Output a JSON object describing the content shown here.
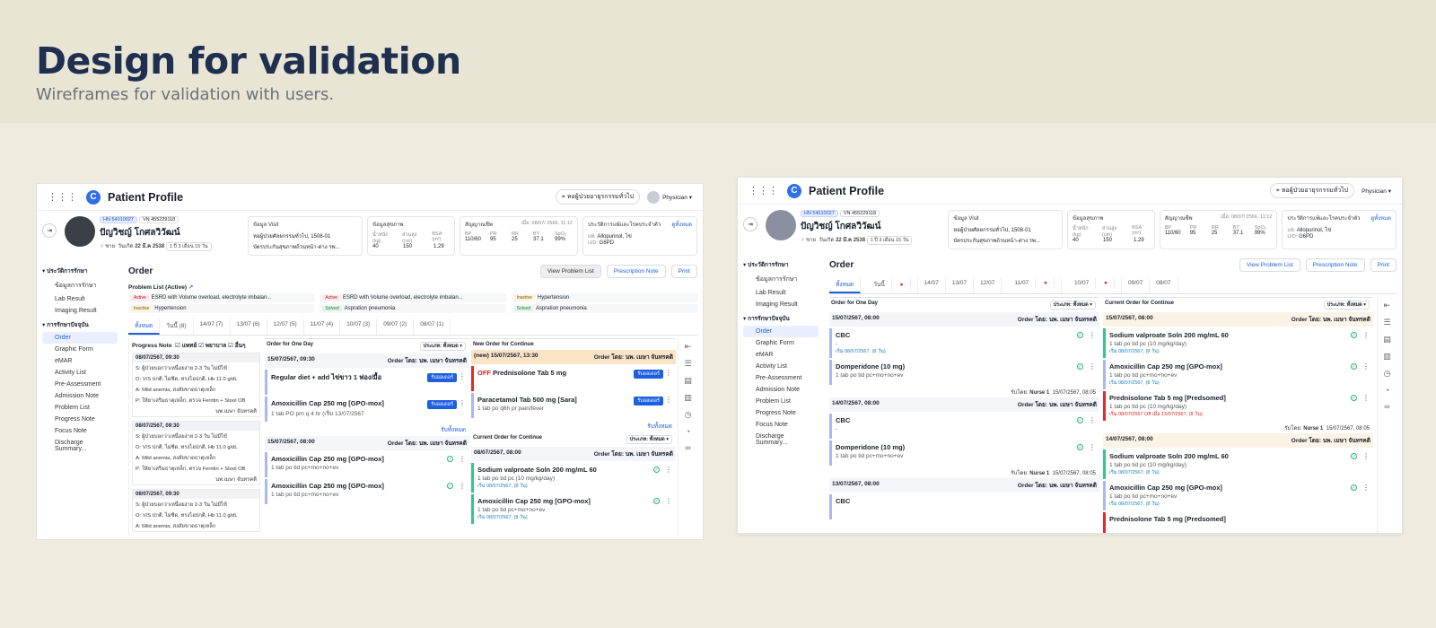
{
  "hero": {
    "title": "Design for validation",
    "subtitle": "Wireframes for validation with users."
  },
  "app": {
    "title": "Patient Profile",
    "location": "หอผู้ป่วยอายุรกรรมทั่วไป",
    "role": "Physician",
    "patient": {
      "hn": "HN 54010027",
      "vn": "VN 455229118",
      "name": "ปัญวิชญ์ โกศลวิวัฒน์",
      "sex": "ชาย",
      "dob_label": "วันเกิด",
      "dob": "22 มี.ค 2538",
      "age": "1 ปี 3 เดือน 15 วัน"
    },
    "visit": {
      "title": "ข้อมูล Visit",
      "ward": "หอผู้ป่วยศัลยกรรมทั่วไป, 1508-01",
      "coverage": "บัตรประกันสุขภาพถ้วนหน้า-ต่าง รพ..."
    },
    "health": {
      "title": "ข้อมูลสุขภาพ",
      "l1": "น้ำหนัก (kg)",
      "l2": "ส่วนสูง (cm)",
      "l3": "BSA (m²)",
      "v1": "40",
      "v2": "150",
      "v3": "1.29"
    },
    "vitals": {
      "title": "สัญญาณชีพ",
      "when": "เมื่อ: 08/07/ 2566, 11:12",
      "l1": "BP",
      "l2": "PR",
      "l3": "RR",
      "l4": "BT",
      "l5": "SpO₂",
      "v1": "110/60",
      "v2": "95",
      "v3": "25",
      "v4": "37.1",
      "v5": "99%"
    },
    "allergy": {
      "title": "ประวัติการแพ้และโรคประจำตัว",
      "all": "ดูทั้งหมด",
      "drug_label": "แพ้:",
      "drug": "Allopurinol, ไข่",
      "dis_label": "U/D:",
      "dis": "G6PD"
    },
    "sidebar": {
      "g1": "ประวัติการรักษา",
      "g2": "การรักษาปัจจุบัน",
      "items1": [
        "ข้อมูลการรักษา",
        "Lab Result",
        "Imaging Result"
      ],
      "items2": [
        "Order",
        "Graphic Form",
        "eMAR",
        "Activity List",
        "Pre-Assessment",
        "Admission Note",
        "Problem List",
        "Progress Note",
        "Focus Note",
        "Discharge Summary..."
      ]
    },
    "main": {
      "title": "Order",
      "btn1": "View Problem List",
      "btn2": "Prescription Note",
      "btn3": "Print"
    },
    "problems": {
      "title": "Problem List (Active)",
      "items": [
        {
          "tag": "Active",
          "text": "ESRD with Volume overload, electrolyte imbalan..."
        },
        {
          "tag": "Active",
          "text": "ESRD with Volume overload, electrolyte imbalan..."
        },
        {
          "tag": "Inactive",
          "text": "Hypertension"
        },
        {
          "tag": "Inactive",
          "text": "Hypertension"
        },
        {
          "tag": "Solved",
          "text": "Aspration pneumonia"
        },
        {
          "tag": "Solved",
          "text": "Aspration pneumonia"
        }
      ]
    },
    "tabsA": [
      "ทั้งหมด",
      "วันนี้ (8)",
      "14/07 (7)",
      "13/07 (6)",
      "12/07 (5)",
      "11/07 (4)",
      "10/07 (3)",
      "09/07 (2)",
      "08/07 (1)"
    ],
    "tabsB": [
      "ทั้งหมด",
      "วันนี้",
      "14/07",
      "13/07",
      "12/07",
      "11/07",
      "10/07",
      "09/07",
      "08/07"
    ],
    "progress": {
      "title": "Progress Note",
      "f1": "แพทย์",
      "f2": "พยาบาล",
      "f3": "อื่นๆ",
      "date": "08/07/2567, 09:30",
      "lines": [
        "S: ผู้ป่วยบอกว่าเหนื่อยง่าย 2-3 วัน ไม่มีไข้",
        "O: V/S ปกติ, ไม่ซีด, ทรงไอปกติ, Hb 11.0 g/dL",
        "A: Mild anemia, สงสัยขาดธาตุเหล็ก",
        "P: ให้ยาเสริมธาตุเหล็ก, ตรวจ Ferritin + Stool OB"
      ],
      "by": "นพ.เมษา จันทรคติ"
    },
    "oneday": {
      "title": "Order for One Day",
      "filter": "ประเภท:",
      "filter_val": "ทั้งหมด",
      "by": "Order โดย:",
      "doctor": "นพ. เมษา จันทรคติ",
      "accept": "รับออเดอร์",
      "accept_all": "รับทั้งหมด",
      "nurse": "รับโดย:",
      "nurse_name": "Nurse 1"
    },
    "ordersA": {
      "d1": "15/07/2567, 09:30",
      "o1": "Regular diet + add ไข่ขาว 1 ฟอง/มื้อ",
      "o2": "Amoxicillin Cap 250 mg [GPO-mox]",
      "o2d": "1 tab PO prn q 4 hr (เริ่ม 13/07/2567",
      "d2": "15/07/2567, 08:00",
      "o3": "Amoxicillin Cap 250 mg [GPO-mox]",
      "o3d": "1 tab po tid pc+mo+no+ev",
      "o4": "Amoxicillin Cap 250 mg [GPO-mox]",
      "o4d": "1 tab po tid pc+mo+no+ev"
    },
    "newcont": {
      "title": "New Order for Continue",
      "date": "(new) 15/07/2567, 13:30",
      "off": "OFF",
      "o1": "Prednisolone Tab 5 mg",
      "o2": "Paracetamol Tab 500 mg [Sara]",
      "o2d": "1 tab po q6h pr pain/fever"
    },
    "curcont": {
      "title": "Current Order for Continue",
      "date": "08/07/2567, 08:00",
      "o1": "Sodium valproate Soln 200 mg/mL 60",
      "o1d": "1 tab po tid pc (10 mg/kg/day)",
      "start": "เริ่ม 08/07/2567, (8 วัน)",
      "o2": "Amoxicillin Cap 250 mg [GPO-mox]",
      "o2d": "1 tab po tid pc+mo+no+ev",
      "o3": "Prednisolone Tab 5 mg [Predsomed]"
    },
    "ordersB": {
      "d1": "15/07/2567, 08:00",
      "d2": "14/07/2567, 08:00",
      "d3": "13/07/2567, 08:00",
      "cbc": "CBC",
      "dash": "-",
      "start": "เริ่ม 08/07/2567, (8 วัน)",
      "dom": "Domperidone (10 mg)",
      "domd": "1 tab po tid pc+mo+no+ev",
      "rtime": "15/07/2567, 08:05",
      "cd1": "15/07/2567, 08:00",
      "cd2": "14/07/2567, 08:00",
      "off_note": "เริ่ม 08/07/2567 Off เมื่อ 15/07/2567, (8 วัน)",
      "o3": "Prednisolone Tab 5 mg [Predsomed]"
    }
  }
}
